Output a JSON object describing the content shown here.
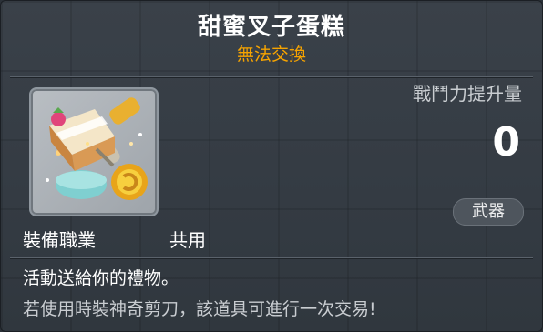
{
  "item": {
    "name": "甜蜜叉子蛋糕",
    "trade_status": "無法交換",
    "icon": "fork-cake-icon"
  },
  "power": {
    "label": "戰鬥力提升量",
    "value": "0"
  },
  "category_badge": "武器",
  "job": {
    "label": "裝備職業",
    "value": "共用"
  },
  "description": {
    "line1": "活動送給你的禮物。",
    "line2": "若使用時裝神奇剪刀，該道具可進行一次交易!"
  },
  "colors": {
    "title": "#ffffff",
    "trade_status": "#f7a400",
    "background": "#343b43"
  }
}
